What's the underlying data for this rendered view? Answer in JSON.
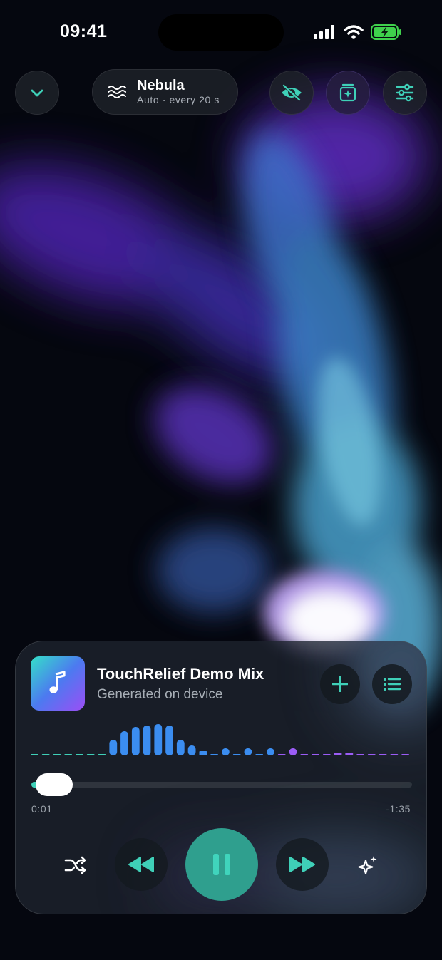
{
  "status_bar": {
    "time": "09:41"
  },
  "header": {
    "visualizer_name": "Nebula",
    "visualizer_mode": "Auto · every 20 s"
  },
  "player": {
    "title": "TouchRelief Demo Mix",
    "subtitle": "Generated on device",
    "elapsed": "0:01",
    "remaining": "-1:35",
    "progress": 0.02,
    "state": "playing"
  },
  "icons": {
    "collapse": "chevron-down-icon",
    "visualizer": "waves-icon",
    "hide": "eye-slash-icon",
    "generate": "sparkle-frame-icon",
    "settings": "sliders-icon",
    "add": "plus-icon",
    "queue": "list-icon",
    "shuffle": "shuffle-icon",
    "rewind": "rewind-icon",
    "pause": "pause-icon",
    "forward": "fast-forward-icon",
    "magic": "sparkles-icon"
  },
  "colors": {
    "accent": "#3fd0b8",
    "accent_dark": "#2f9f8e",
    "bar_blue": "#3b8df0",
    "bar_purple": "#9b5cf5"
  }
}
